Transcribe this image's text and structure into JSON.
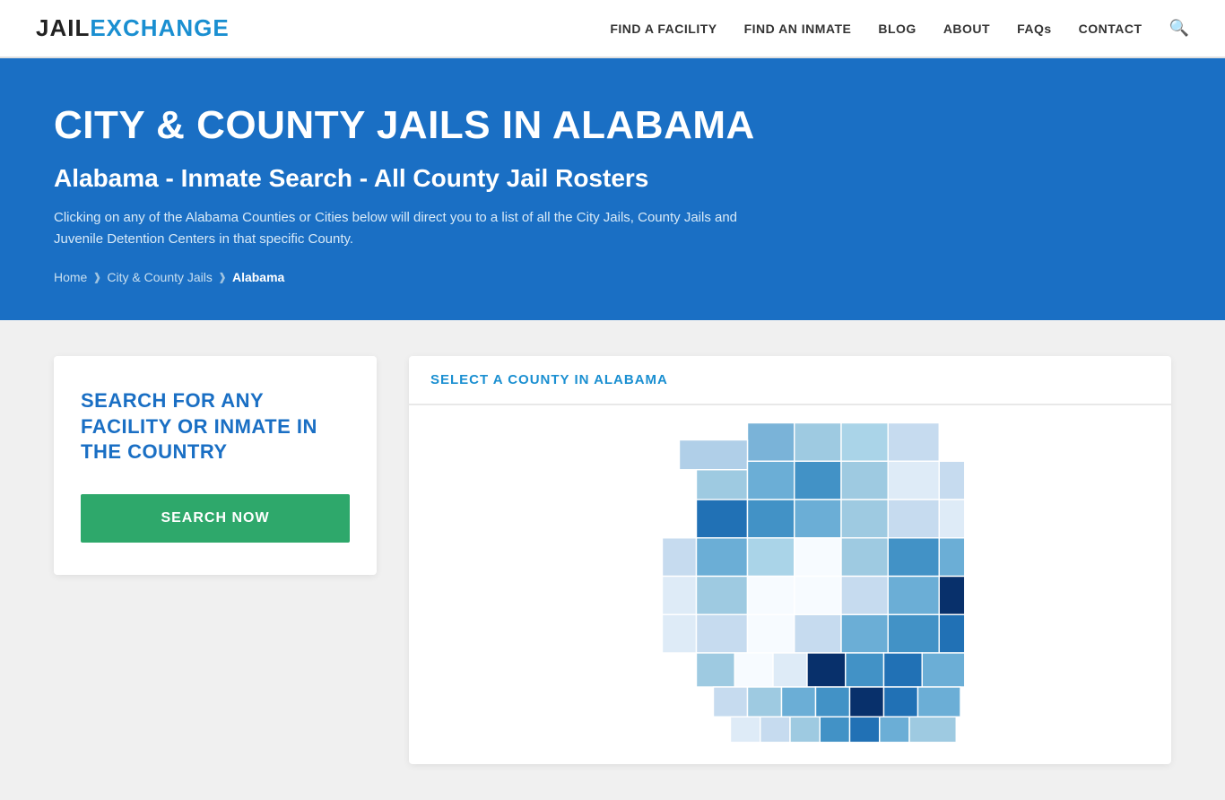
{
  "navbar": {
    "logo_jail": "JAIL",
    "logo_exchange": "EXCHANGE",
    "nav_items": [
      {
        "label": "FIND A FACILITY",
        "id": "find-facility"
      },
      {
        "label": "FIND AN INMATE",
        "id": "find-inmate"
      },
      {
        "label": "BLOG",
        "id": "blog"
      },
      {
        "label": "ABOUT",
        "id": "about"
      },
      {
        "label": "FAQs",
        "id": "faqs"
      },
      {
        "label": "CONTACT",
        "id": "contact"
      }
    ]
  },
  "hero": {
    "title": "CITY & COUNTY JAILS IN ALABAMA",
    "subtitle": "Alabama - Inmate Search - All County Jail Rosters",
    "description": "Clicking on any of the Alabama Counties or Cities below will direct you to a list of all the City Jails, County Jails and Juvenile Detention Centers in that specific County.",
    "breadcrumb": {
      "home": "Home",
      "city_county": "City & County Jails",
      "current": "Alabama"
    }
  },
  "search_box": {
    "heading": "SEARCH FOR ANY FACILITY OR INMATE IN THE COUNTRY",
    "button_label": "SEARCH NOW"
  },
  "map_section": {
    "heading": "SELECT A COUNTY IN ALABAMA"
  }
}
